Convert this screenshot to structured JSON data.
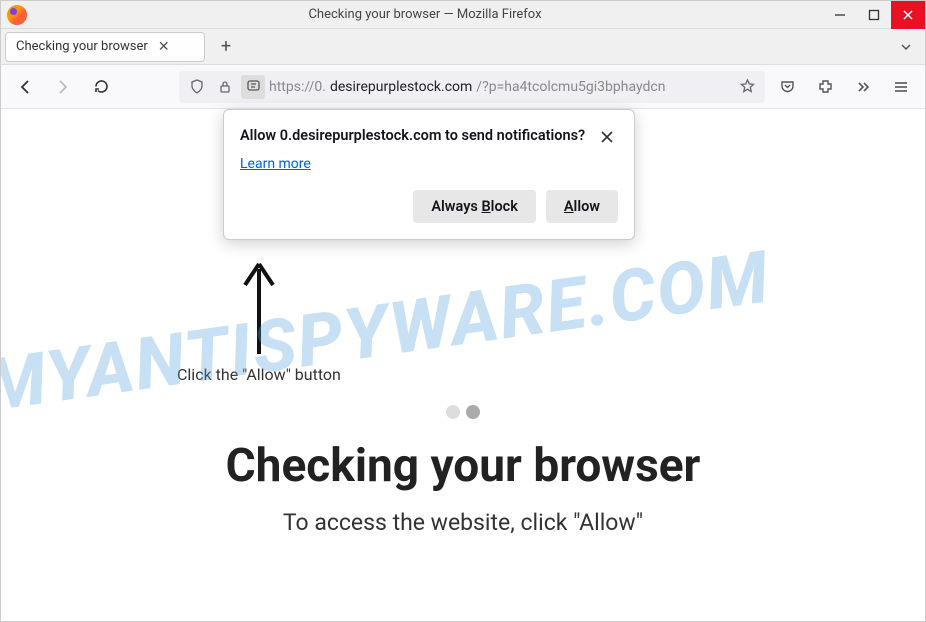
{
  "titlebar": {
    "title": "Checking your browser — Mozilla Firefox"
  },
  "tab": {
    "title": "Checking your browser"
  },
  "url": {
    "prefix": "https://0.",
    "domain": "desirepurplestock.com",
    "rest": "/?p=ha4tcolcmu5gi3bphaydcn"
  },
  "popup": {
    "title": "Allow 0.desirepurplestock.com to send notifications?",
    "learn": "Learn more",
    "block_pre": "Always ",
    "block_u": "B",
    "block_post": "lock",
    "allow_u": "A",
    "allow_post": "llow"
  },
  "page": {
    "click": "Click the \"Allow\" button",
    "heading": "Checking your browser",
    "sub": "To access the website, click \"Allow\""
  },
  "watermark": "MYANTISPYWARE.COM"
}
